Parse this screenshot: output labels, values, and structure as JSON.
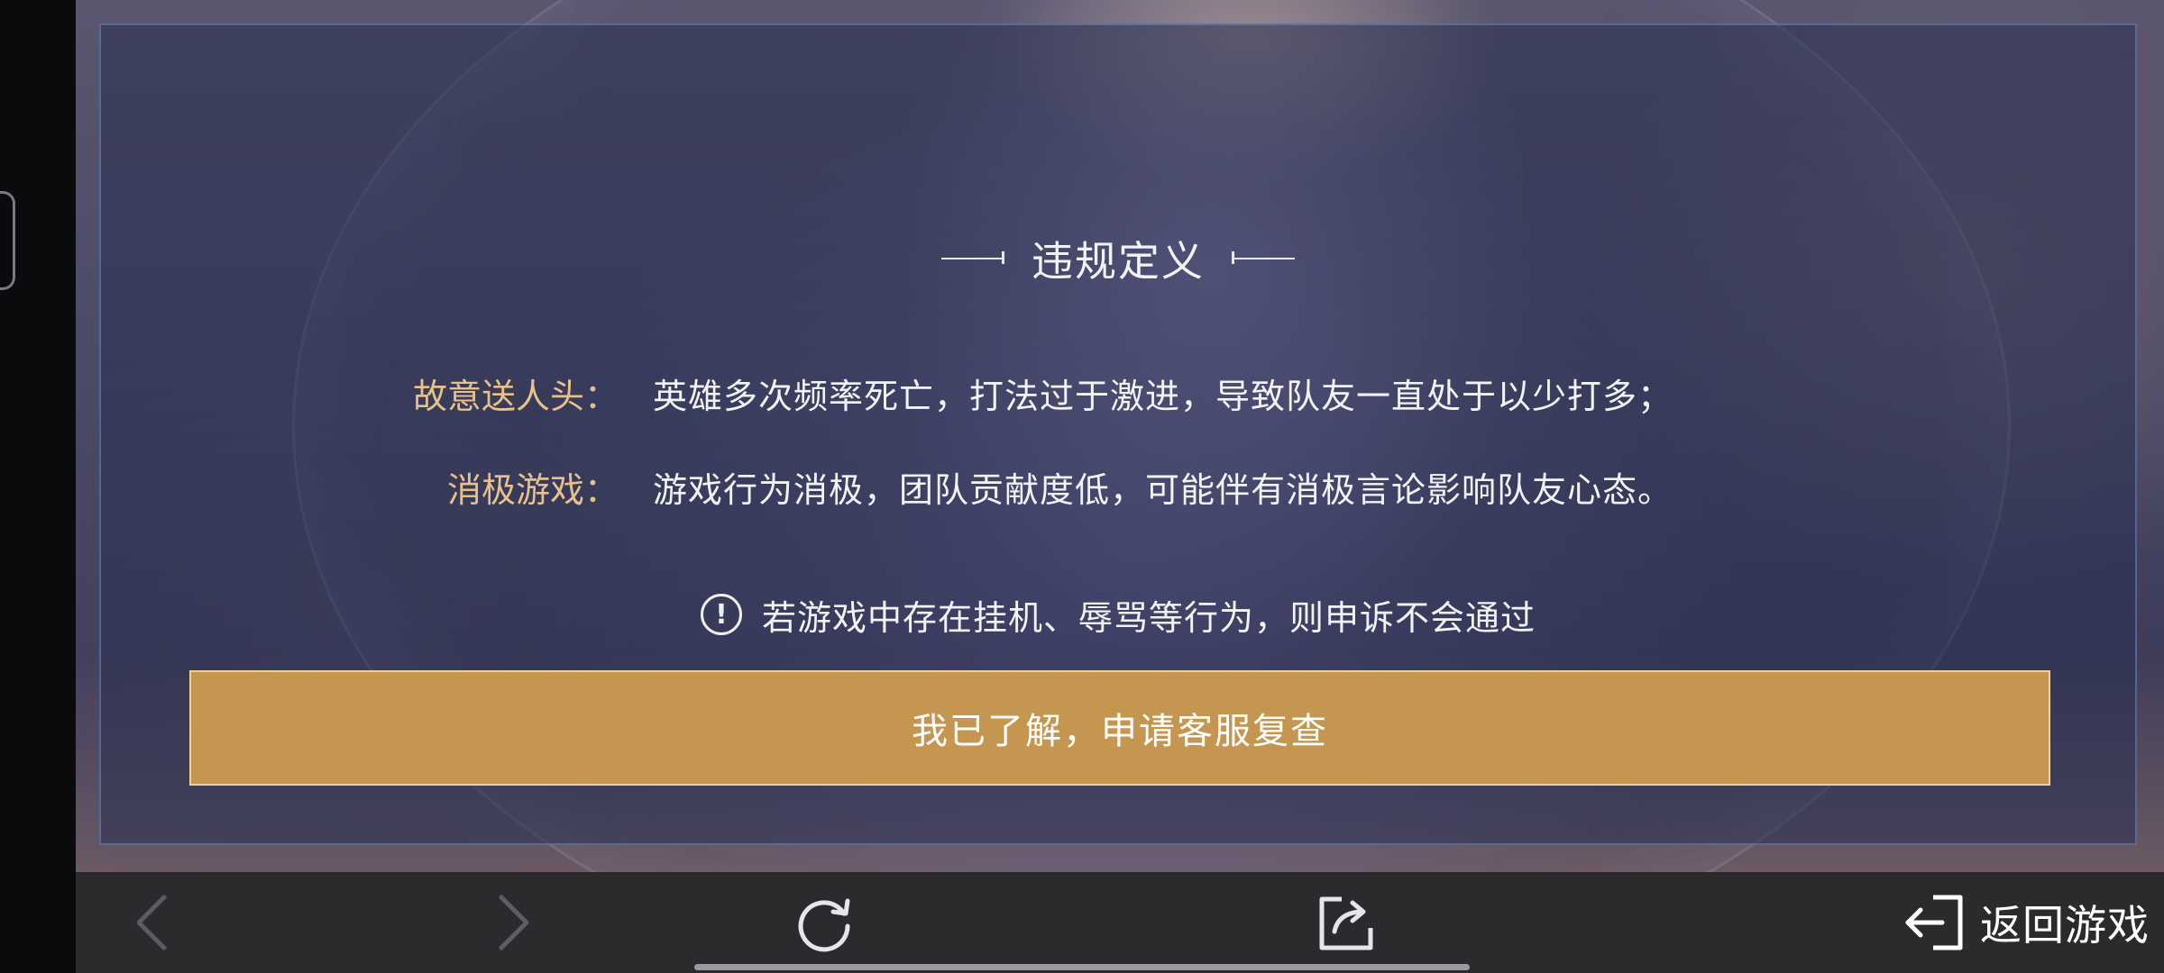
{
  "dialog": {
    "title": "违规定义",
    "definitions": [
      {
        "term": "故意送人头：",
        "description": "英雄多次频率死亡，打法过于激进，导致队友一直处于以少打多；"
      },
      {
        "term": "消极游戏：",
        "description": "游戏行为消极，团队贡献度低，可能伴有消极言论影响队友心态。"
      }
    ],
    "notice": "若游戏中存在挂机、辱骂等行为，则申诉不会通过",
    "notice_icon": "!",
    "confirm_button": "我已了解，申请客服复查"
  },
  "bottom_bar": {
    "return_label": "返回游戏"
  },
  "colors": {
    "accent_gold": "#c4964f",
    "term_gold": "#e7c189",
    "panel_border": "#6e8cc8",
    "bar_bg": "#2b2b2e"
  }
}
